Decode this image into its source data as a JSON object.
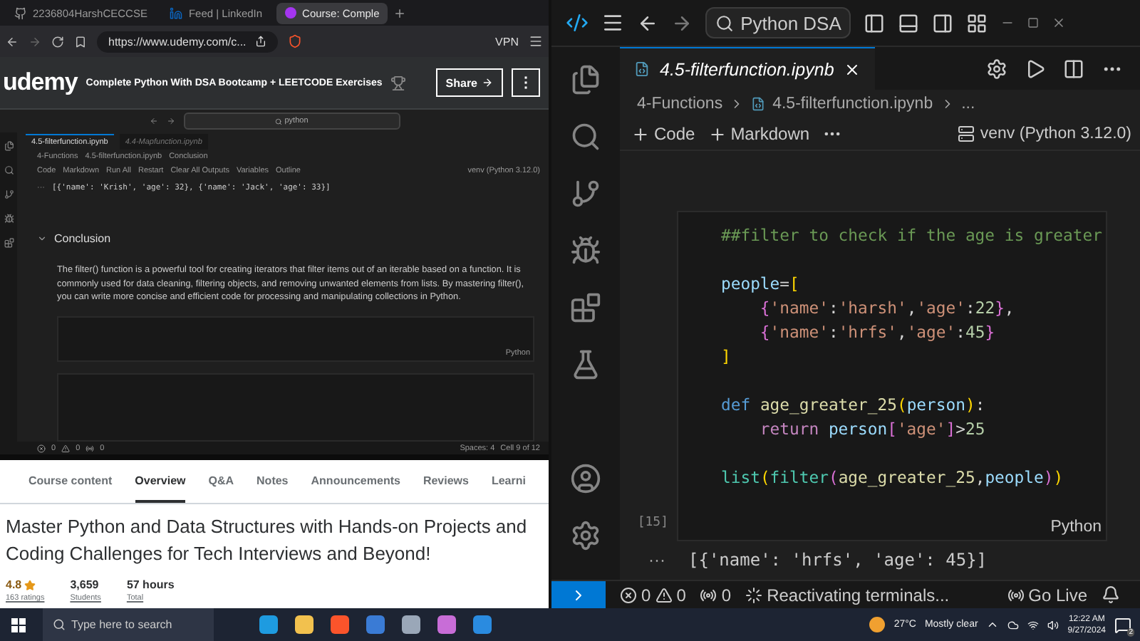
{
  "browser": {
    "tabs": [
      {
        "label": "2236804HarshCECCSE",
        "selected": false,
        "kind": "github"
      },
      {
        "label": "Feed | LinkedIn",
        "selected": false,
        "kind": "linkedin"
      },
      {
        "label": "Course: Comple",
        "selected": true,
        "kind": "udemy"
      }
    ],
    "url": "https://www.udemy.com/c...",
    "vpn": "VPN",
    "site": {
      "logo": "udemy",
      "course_title": "Complete Python With DSA Bootcamp + LEETCODE Exercises",
      "share": "Share",
      "more": "⋮"
    },
    "video": {
      "search": "python",
      "tabs": [
        {
          "label": "4.5-filterfunction.ipynb",
          "selected": true
        },
        {
          "label": "4.4-Mapfunction.ipynb",
          "selected": false
        }
      ],
      "breadcrumb": [
        "4-Functions",
        "4.5-filterfunction.ipynb",
        "Conclusion"
      ],
      "toolbar": [
        "Code",
        "Markdown",
        "Run All",
        "Restart",
        "Clear All Outputs",
        "Variables",
        "Outline"
      ],
      "kernel": "venv (Python 3.12.0)",
      "output_more": "···",
      "output": "[{'name': 'Krish', 'age': 32}, {'name': 'Jack', 'age': 33}]",
      "heading": "Conclusion",
      "paragraph": "The filter() function is a powerful tool for creating iterators that filter items out of an iterable based on a function. It is commonly used for data cleaning, filtering objects, and removing unwanted elements from lists. By mastering filter(), you can write more concise and efficient code for processing and manipulating collections in Python.",
      "cell_language": "Python",
      "status": {
        "errors": "0",
        "warnings": "0",
        "ports": "0",
        "spaces": "Spaces: 4",
        "cell": "Cell 9 of 12"
      }
    },
    "course_tabs": [
      {
        "label": "Course content",
        "selected": false
      },
      {
        "label": "Overview",
        "selected": true
      },
      {
        "label": "Q&A",
        "selected": false
      },
      {
        "label": "Notes",
        "selected": false
      },
      {
        "label": "Announcements",
        "selected": false
      },
      {
        "label": "Reviews",
        "selected": false
      },
      {
        "label": "Learni",
        "selected": false
      }
    ],
    "headline": "Master Python and Data Structures with Hands-on Projects and Coding Challenges for Tech Interviews and Beyond!",
    "stats": [
      {
        "kind": "rating",
        "value": "4.8",
        "label": "163 ratings"
      },
      {
        "kind": "plain",
        "value": "3,659",
        "label": "Students"
      },
      {
        "kind": "plain",
        "value": "57 hours",
        "label": "Total"
      }
    ]
  },
  "editor": {
    "search": "Python DSA",
    "tab": {
      "label": "4.5-filterfunction.ipynb",
      "selected": true
    },
    "breadcrumb": [
      "4-Functions",
      "4.5-filterfunction.ipynb",
      "..."
    ],
    "toolbar": [
      "Code",
      "Markdown"
    ],
    "kernel": "venv (Python 3.12.0)",
    "cell": {
      "count": "[15]",
      "language": "Python",
      "lines": [
        {
          "kind": "code",
          "tokens": [
            {
              "kind": "comment",
              "text": "##filter to check if the age is greater"
            }
          ]
        },
        {
          "kind": "blank"
        },
        {
          "kind": "code",
          "tokens": [
            {
              "kind": "variable",
              "text": "people"
            },
            {
              "kind": "punct",
              "text": "="
            },
            {
              "kind": "bracket",
              "text": "["
            }
          ]
        },
        {
          "kind": "code",
          "tokens": [
            {
              "kind": "bracket2",
              "text": "    {"
            },
            {
              "kind": "string",
              "text": "'name'"
            },
            {
              "kind": "punct",
              "text": ":"
            },
            {
              "kind": "string",
              "text": "'harsh'"
            },
            {
              "kind": "punct",
              "text": ","
            },
            {
              "kind": "string",
              "text": "'age'"
            },
            {
              "kind": "punct",
              "text": ":"
            },
            {
              "kind": "number",
              "text": "22"
            },
            {
              "kind": "bracket2",
              "text": "}"
            },
            {
              "kind": "punct",
              "text": ","
            }
          ]
        },
        {
          "kind": "code",
          "tokens": [
            {
              "kind": "bracket2",
              "text": "    {"
            },
            {
              "kind": "string",
              "text": "'name'"
            },
            {
              "kind": "punct",
              "text": ":"
            },
            {
              "kind": "string",
              "text": "'hrfs'"
            },
            {
              "kind": "punct",
              "text": ","
            },
            {
              "kind": "string",
              "text": "'age'"
            },
            {
              "kind": "punct",
              "text": ":"
            },
            {
              "kind": "number",
              "text": "45"
            },
            {
              "kind": "bracket2",
              "text": "}"
            }
          ]
        },
        {
          "kind": "code",
          "tokens": [
            {
              "kind": "bracket",
              "text": "]"
            }
          ]
        },
        {
          "kind": "blank"
        },
        {
          "kind": "code",
          "tokens": [
            {
              "kind": "keyword",
              "text": "def "
            },
            {
              "kind": "function",
              "text": "age_greater_25"
            },
            {
              "kind": "bracket",
              "text": "("
            },
            {
              "kind": "variable",
              "text": "person"
            },
            {
              "kind": "bracket",
              "text": ")"
            },
            {
              "kind": "punct",
              "text": ":"
            }
          ]
        },
        {
          "kind": "code",
          "tokens": [
            {
              "kind": "control",
              "text": "    return "
            },
            {
              "kind": "variable",
              "text": "person"
            },
            {
              "kind": "bracket2",
              "text": "["
            },
            {
              "kind": "string",
              "text": "'age'"
            },
            {
              "kind": "bracket2",
              "text": "]"
            },
            {
              "kind": "punct",
              "text": ">"
            },
            {
              "kind": "number",
              "text": "25"
            }
          ]
        },
        {
          "kind": "blank"
        },
        {
          "kind": "code",
          "tokens": [
            {
              "kind": "builtin",
              "text": "list"
            },
            {
              "kind": "bracket",
              "text": "("
            },
            {
              "kind": "builtin",
              "text": "filter"
            },
            {
              "kind": "bracket2",
              "text": "("
            },
            {
              "kind": "function",
              "text": "age_greater_25"
            },
            {
              "kind": "punct",
              "text": ","
            },
            {
              "kind": "variable",
              "text": "people"
            },
            {
              "kind": "bracket2",
              "text": ")"
            },
            {
              "kind": "bracket",
              "text": ")"
            }
          ]
        }
      ]
    },
    "output_more": "···",
    "output": "[{'name': 'hrfs', 'age': 45}]",
    "status": {
      "errors": "0",
      "warnings": "0",
      "ports": "0",
      "message": "Reactivating terminals...",
      "live": "Go Live"
    }
  },
  "taskbar": {
    "search": {
      "placeholder": "Type here to search"
    },
    "apps": [
      {
        "color": "#1e9be0"
      },
      {
        "color": "#f2c14e"
      },
      {
        "color": "#fb542b"
      },
      {
        "color": "#3a7bd5"
      },
      {
        "color": "#9aa7b8"
      },
      {
        "color": "#c86dd7"
      },
      {
        "color": "#2a8be0"
      }
    ],
    "temperature": "27°C",
    "weather": "Mostly clear",
    "time": "12:22 AM",
    "date": "9/27/2024",
    "notifications": "2"
  }
}
